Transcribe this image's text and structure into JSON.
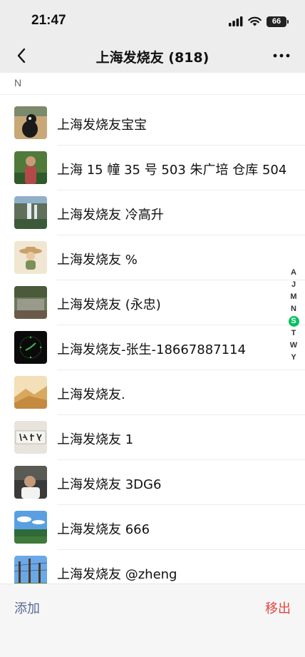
{
  "status": {
    "time": "21:47",
    "battery": "66"
  },
  "nav": {
    "title": "上海发烧友 (818)"
  },
  "section": {
    "letter": "N"
  },
  "members": [
    {
      "name": " 上海发烧友宝宝"
    },
    {
      "name": "上海 15 幢 35 号 503  朱广培 仓库 504"
    },
    {
      "name": "上海发烧友 冷高升"
    },
    {
      "name": "上海发烧友 %"
    },
    {
      "name": "上海发烧友 (永忠)"
    },
    {
      "name": "上海发烧友-张生-18667887114"
    },
    {
      "name": "上海发烧友."
    },
    {
      "name": "上海发烧友 1"
    },
    {
      "name": "上海发烧友 3DG6"
    },
    {
      "name": "上海发烧友 666"
    },
    {
      "name": "上海发烧友 @zheng"
    }
  ],
  "index": [
    "A",
    "J",
    "M",
    "N",
    "S",
    "T",
    "W",
    "Y"
  ],
  "index_active": "S",
  "bottom": {
    "add_label": "添加",
    "remove_label": "移出"
  },
  "colors": {
    "accent_green": "#07c160",
    "link_blue": "#576b95",
    "danger_red": "#e64340"
  }
}
